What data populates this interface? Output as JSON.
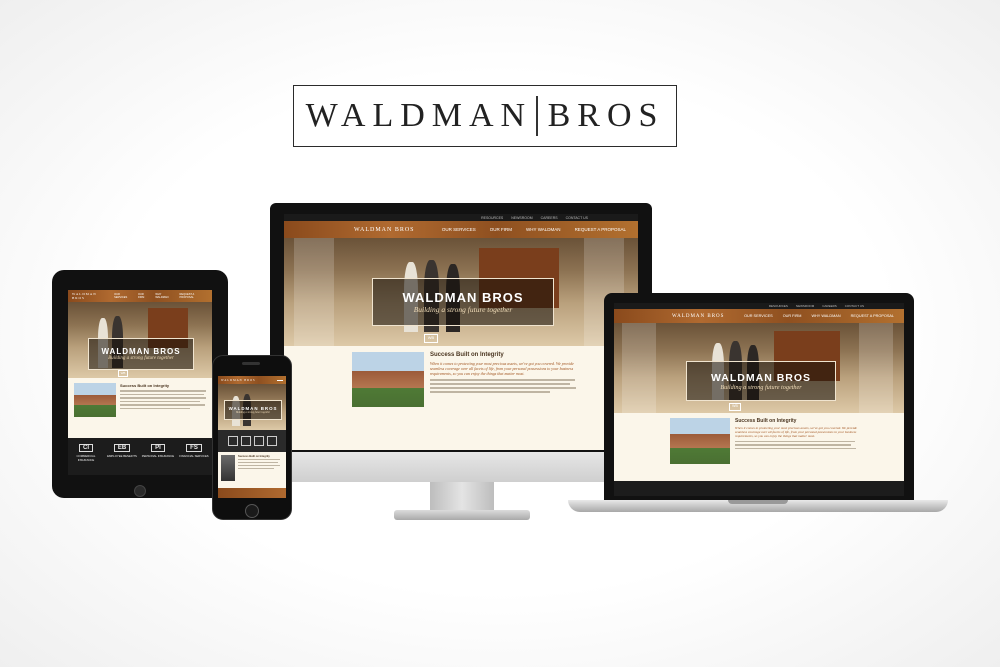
{
  "logo": {
    "left": "WALDMAN",
    "right": "BROS"
  },
  "site": {
    "brand": "WALDMAN BROS",
    "top_links": [
      "RESOURCES",
      "NEWSROOM",
      "CAREERS",
      "CONTACT US"
    ],
    "nav": [
      "OUR SERVICES",
      "OUR FIRM",
      "WHY WALDMAN",
      "REQUEST A PROPOSAL"
    ],
    "hero_title": "WALDMAN BROS",
    "hero_subtitle": "Building a strong future together",
    "wb": "WB",
    "section_title": "Success Built on Integrity",
    "intro": "When it comes to protecting your most precious assets, we've got you covered. We provide seamless coverage over all facets of life, from your personal possessions to your business requirements, so you can enjoy the things that matter most.",
    "services": [
      {
        "abbr": "CI",
        "name": "COMMERCIAL INSURANCE"
      },
      {
        "abbr": "EB",
        "name": "EMPLOYEE BENEFITS"
      },
      {
        "abbr": "PI",
        "name": "PERSONAL INSURANCE"
      },
      {
        "abbr": "FS",
        "name": "FINANCIAL SERVICES"
      }
    ]
  },
  "colors": {
    "nav_wood": "#b06a30",
    "cream": "#fbf6ea",
    "brown_text": "#a0521d"
  }
}
